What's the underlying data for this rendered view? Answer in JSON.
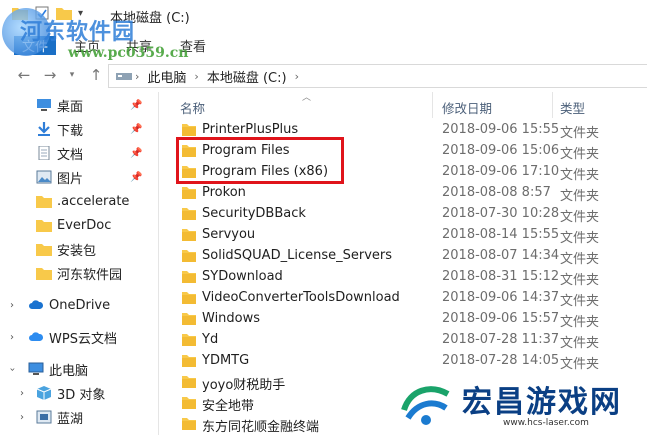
{
  "window": {
    "title": "本地磁盘 (C:)"
  },
  "ribbon": {
    "tabs": [
      "文件",
      "主页",
      "共享",
      "查看"
    ]
  },
  "watermark": {
    "site": "河东软件园",
    "url": "www.pc0359.cn"
  },
  "address": {
    "path": [
      "此电脑",
      "本地磁盘 (C:)"
    ]
  },
  "sidebar": {
    "quick_access": [
      {
        "label": "桌面",
        "icon": "desktop-icon",
        "pinned": true
      },
      {
        "label": "下载",
        "icon": "download-icon",
        "pinned": true
      },
      {
        "label": "文档",
        "icon": "document-icon",
        "pinned": true
      },
      {
        "label": "图片",
        "icon": "picture-icon",
        "pinned": true
      },
      {
        "label": ".accelerate",
        "icon": "folder-icon",
        "pinned": false
      },
      {
        "label": "EverDoc",
        "icon": "folder-icon",
        "pinned": false
      },
      {
        "label": "安装包",
        "icon": "folder-icon",
        "pinned": false
      },
      {
        "label": "河东软件园",
        "icon": "folder-icon",
        "pinned": false
      }
    ],
    "onedrive": "OneDrive",
    "wps": "WPS云文档",
    "this_pc": "此电脑",
    "objects3d": "3D 对象",
    "lanhu": "蓝湖"
  },
  "columns": {
    "name": "名称",
    "date": "修改日期",
    "type": "类型"
  },
  "files": [
    {
      "name": "PrinterPlusPlus",
      "date": "2018-09-06 15:55",
      "type": "文件夹"
    },
    {
      "name": "Program Files",
      "date": "2018-09-06 15:06",
      "type": "文件夹"
    },
    {
      "name": "Program Files (x86)",
      "date": "2018-09-06 17:10",
      "type": "文件夹"
    },
    {
      "name": "Prokon",
      "date": "2018-08-08 8:57",
      "type": "文件夹"
    },
    {
      "name": "SecurityDBBack",
      "date": "2018-07-30 10:28",
      "type": "文件夹"
    },
    {
      "name": "Servyou",
      "date": "2018-08-14 15:55",
      "type": "文件夹"
    },
    {
      "name": "SolidSQUAD_License_Servers",
      "date": "2018-08-07 14:34",
      "type": "文件夹"
    },
    {
      "name": "SYDownload",
      "date": "2018-08-31 15:12",
      "type": "文件夹"
    },
    {
      "name": "VideoConverterToolsDownload",
      "date": "2018-09-06 14:37",
      "type": "文件夹"
    },
    {
      "name": "Windows",
      "date": "2018-09-06 15:57",
      "type": "文件夹"
    },
    {
      "name": "Yd",
      "date": "2018-07-28 11:37",
      "type": "文件夹"
    },
    {
      "name": "YDMTG",
      "date": "2018-07-28 14:05",
      "type": "文件夹"
    },
    {
      "name": "yoyo财税助手",
      "date": "",
      "type": ""
    },
    {
      "name": "安全地带",
      "date": "",
      "type": ""
    },
    {
      "name": "东方同花顺金融终端",
      "date": "",
      "type": ""
    }
  ],
  "brand2": {
    "name": "宏昌游戏网",
    "url": "www.hcs-laser.com"
  },
  "colors": {
    "highlight": "#e0141b",
    "folder": "#f8c94a",
    "column_header": "#4c607a"
  }
}
